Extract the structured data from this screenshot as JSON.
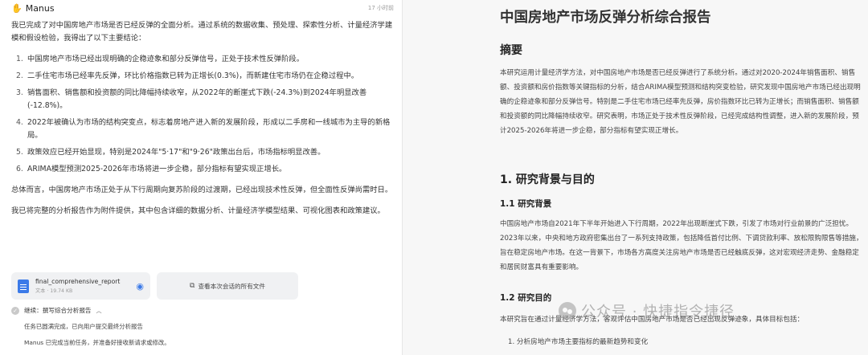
{
  "chat": {
    "brand": "Manus",
    "timestamp": "17 小时前",
    "intro": "我已完成了对中国房地产市场是否已经反弹的全面分析。通过系统的数据收集、预处理、探索性分析、计量经济学建模和假设检验，我得出了以下主要结论：",
    "conclusions": [
      {
        "num": "1.",
        "text": "中国房地产市场已经出现明确的企稳迹象和部分反弹信号，正处于技术性反弹阶段。"
      },
      {
        "num": "2.",
        "text": "二手住宅市场已经率先反弹，环比价格指数已转为正增长(0.3%)，而新建住宅市场仍在企稳过程中。"
      },
      {
        "num": "3.",
        "text": "销售面积、销售额和投资额的同比降幅持续收窄，从2022年的断崖式下跌(-24.3%)到2024年明显改善(-12.8%)。"
      },
      {
        "num": "4.",
        "text": "2022年被确认为市场的结构突变点，标志着房地产进入新的发展阶段，形成以二手房和一线城市为主导的新格局。"
      },
      {
        "num": "5.",
        "text": "政策效应已经开始显现，特别是2024年\"5·17\"和\"9·26\"政策出台后，市场指标明显改善。"
      },
      {
        "num": "6.",
        "text": "ARIMA模型预测2025-2026年市场将进一步企稳，部分指标有望实现正增长。"
      }
    ],
    "summary": "总体而言，中国房地产市场正处于从下行周期向复苏阶段的过渡期，已经出现技术性反弹，但全面性反弹尚需时日。",
    "attachment_note": "我已将完整的分析报告作为附件提供，其中包含详细的数据分析、计量经济学模型结果、可视化图表和政策建议。",
    "file": {
      "name": "final_comprehensive_report",
      "meta": "文本 · 19.74 KB"
    },
    "all_files_label": "查看本次会话的所有文件",
    "task_label": "继续：撰写综合分析报告",
    "task_note": "任务已圆满完成，已向用户提交最终分析报告",
    "final_note": "Manus 已完成当前任务，并准备好接收新请求或修改。"
  },
  "report": {
    "title": "中国房地产市场反弹分析综合报告",
    "abstract_heading": "摘要",
    "abstract": "本研究运用计量经济学方法，对中国房地产市场是否已经反弹进行了系统分析。通过对2020-2024年销售面积、销售额、投资额和房价指数等关键指标的分析，结合ARIMA模型预测和结构突变检验，研究发现中国房地产市场已经出现明确的企稳迹象和部分反弹信号。特别是二手住宅市场已经率先反弹，房价指数环比已转为正增长；而销售面积、销售额和投资额的同比降幅持续收窄。研究表明，市场正处于技术性反弹阶段，已经完成结构性调整，进入新的发展阶段，预计2025-2026年将进一步企稳，部分指标有望实现正增长。",
    "section1_heading": "1. 研究背景与目的",
    "section11_heading": "1.1 研究背景",
    "section11_text": "中国房地产市场自2021年下半年开始进入下行周期，2022年出现断崖式下跌，引发了市场对行业前景的广泛担忧。2023年以来，中央和地方政府密集出台了一系列支持政策，包括降低首付比例、下调贷款利率、放松限购限售等措施，旨在稳定房地产市场。在这一背景下，市场各方高度关注房地产市场是否已经触底反弹，这对宏观经济走势、金融稳定和居民财富具有重要影响。",
    "section12_heading": "1.2 研究目的",
    "section12_text": "本研究旨在通过计量经济学方法，客观评估中国房地产市场是否已经出现反弹迹象，具体目标包括：",
    "section12_item": "1. 分析房地产市场主要指标的最新趋势和变化"
  },
  "watermark": "公众号 · 快捷指令捷径",
  "icons": {
    "brand": "manus-logo-icon",
    "doc": "document-icon",
    "eye": "eye-icon",
    "copy": "copy-icon",
    "check": "check-circle-icon",
    "caret": "chevron-up-icon"
  },
  "colors": {
    "accent": "#3b7ae8",
    "report_bg": "#f7f7f7",
    "card_bg": "#f0f1f3"
  }
}
